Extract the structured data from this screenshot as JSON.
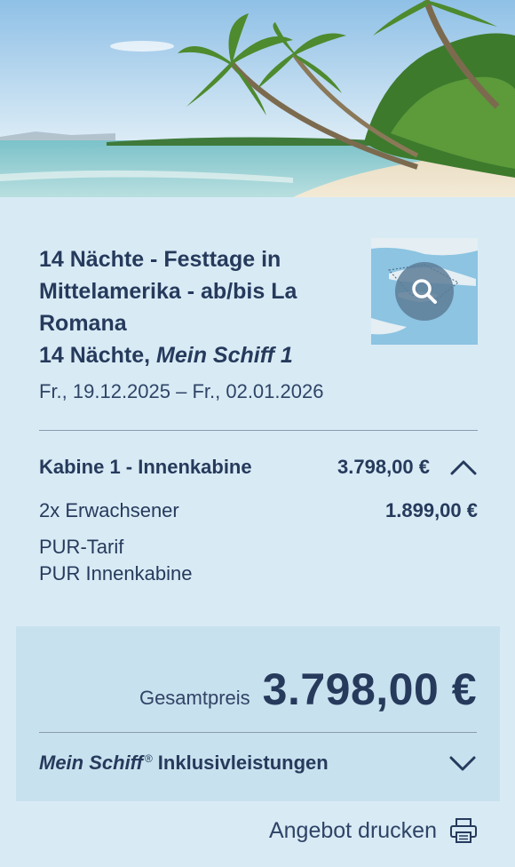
{
  "trip": {
    "title": "14 Nächte - Festtage in Mittelamerika - ab/bis La Romana",
    "nights_prefix": "14 Nächte, ",
    "ship": "Mein Schiff 1",
    "dates": "Fr., 19.12.2025 – Fr., 02.01.2026"
  },
  "cabin": {
    "label": "Kabine 1 - Innenkabine",
    "price": "3.798,00 €",
    "travellers_label": "2x Erwachsener",
    "travellers_price": "1.899,00 €",
    "tariff": "PUR-Tarif",
    "cabin_type": "PUR Innenkabine"
  },
  "total": {
    "label": "Gesamtpreis",
    "value": "3.798,00 €"
  },
  "inclusive": {
    "brand": "Mein Schiff",
    "reg_mark": "®",
    "label": "Inklusivleistungen"
  },
  "print": {
    "label": "Angebot drucken"
  },
  "icons": {
    "map_zoom": "search-icon",
    "cabin_toggle": "chevron-up-icon",
    "inclusive_toggle": "chevron-down-icon",
    "print": "printer-icon"
  },
  "colors": {
    "background": "#d8ebf5",
    "panel": "#c8e1ee",
    "text": "#263a5c"
  }
}
